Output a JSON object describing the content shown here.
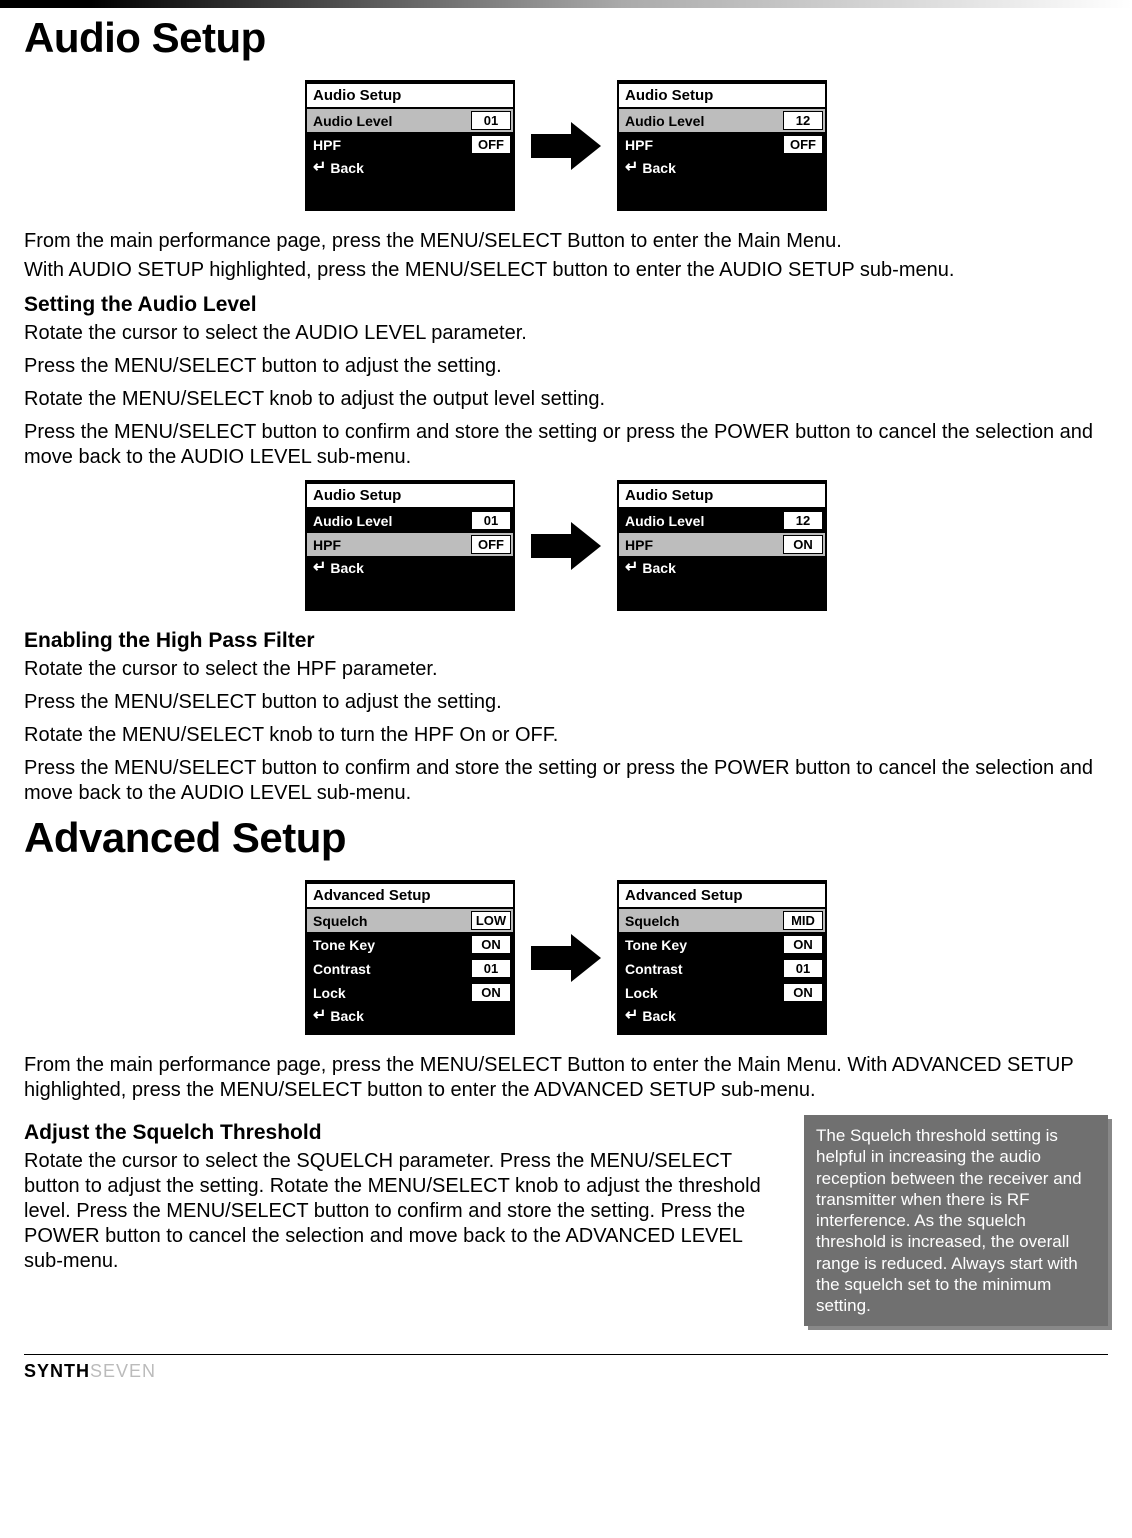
{
  "headings": {
    "audio_setup": "Audio Setup",
    "advanced_setup": "Advanced Setup",
    "setting_audio_level": "Setting the Audio Level",
    "enabling_hpf": "Enabling the High Pass Filter",
    "adjust_squelch": "Adjust the Squelch Threshold"
  },
  "paragraphs": {
    "audio_intro1": "From the main performance page, press the MENU/SELECT Button to enter the Main Menu.",
    "audio_intro2": "With AUDIO SETUP highlighted, press the MENU/SELECT button to enter the AUDIO SETUP sub-menu.",
    "al1": "Rotate the cursor to select the AUDIO LEVEL parameter.",
    "al2": "Press the MENU/SELECT button to adjust the setting.",
    "al3": "Rotate the MENU/SELECT knob to adjust the output level setting.",
    "al4": "Press the MENU/SELECT button to confirm and store the setting or press the POWER button to cancel the selection and move back to the AUDIO LEVEL sub-menu.",
    "hpf1": "Rotate the cursor to select the HPF parameter.",
    "hpf2": "Press the MENU/SELECT button to adjust the setting.",
    "hpf3": "Rotate the MENU/SELECT knob to turn the HPF On or OFF.",
    "hpf4": "Press the MENU/SELECT button to confirm and store the setting or press the POWER button to cancel the selection and move back to the AUDIO LEVEL sub-menu.",
    "adv_intro": "From the main performance page, press the MENU/SELECT Button to enter the Main Menu. With ADVANCED SETUP highlighted, press the MENU/SELECT button to enter the ADVANCED SETUP sub-menu.",
    "sq1": "Rotate the cursor to select the SQUELCH parameter. Press the MENU/SELECT button to adjust the setting. Rotate the MENU/SELECT knob to adjust the threshold level. Press the MENU/SELECT button to confirm and store the setting. Press the POWER button to cancel the selection and move back to the ADVANCED LEVEL sub-menu."
  },
  "note": "The Squelch threshold setting is helpful in increasing the audio reception between the receiver and transmitter when there is RF interference. As the squelch threshold is increased, the overall range is reduced. Always start with the squelch set to the minimum setting.",
  "lcd_common": {
    "audio_title": "Audio Setup",
    "advanced_title": "Advanced Setup",
    "audio_level": "Audio Level",
    "hpf": "HPF",
    "squelch": "Squelch",
    "tone_key": "Tone Key",
    "contrast": "Contrast",
    "lock": "Lock",
    "back": "Back"
  },
  "screens": {
    "a1": {
      "selected": "audio_level",
      "audio_level": "01",
      "hpf": "OFF"
    },
    "a2": {
      "selected": "audio_level",
      "audio_level": "12",
      "hpf": "OFF"
    },
    "b1": {
      "selected": "hpf",
      "audio_level": "01",
      "hpf": "OFF"
    },
    "b2": {
      "selected": "hpf",
      "audio_level": "12",
      "hpf": "ON"
    },
    "c1": {
      "selected": "squelch",
      "squelch": "LOW",
      "tone_key": "ON",
      "contrast": "01",
      "lock": "ON"
    },
    "c2": {
      "selected": "squelch",
      "squelch": "MID",
      "tone_key": "ON",
      "contrast": "01",
      "lock": "ON"
    }
  },
  "footer": {
    "brand1": "SYNTH",
    "brand2": "SEVEN"
  }
}
